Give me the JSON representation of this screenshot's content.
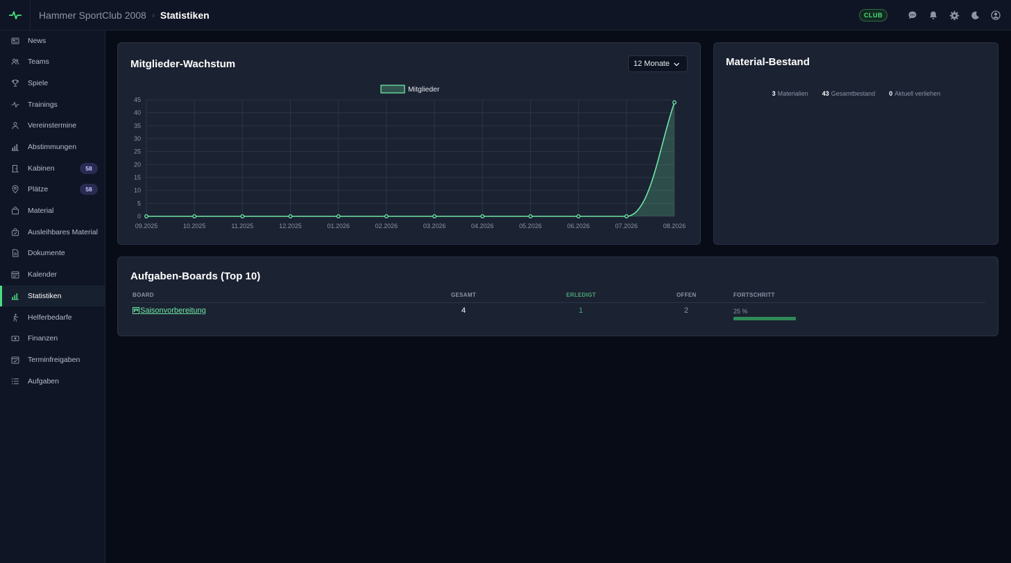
{
  "header": {
    "club_name": "Hammer SportClub 2008",
    "page_title": "Statistiken",
    "badge": "CLUB"
  },
  "icons": {
    "logo": "pulse-icon",
    "chat": "chat-icon",
    "notifications": "bell-icon",
    "settings": "gear-icon",
    "theme": "moon-icon",
    "account": "user-circle-icon"
  },
  "colors": {
    "accent": "#4ade80",
    "series": "#6ee7a6",
    "badge_bg": "#2a2a52"
  },
  "sidebar": {
    "items": [
      {
        "label": "News",
        "icon": "newspaper-icon"
      },
      {
        "label": "Teams",
        "icon": "users-icon"
      },
      {
        "label": "Spiele",
        "icon": "trophy-icon"
      },
      {
        "label": "Trainings",
        "icon": "pulse-icon"
      },
      {
        "label": "Vereinstermine",
        "icon": "person-icon"
      },
      {
        "label": "Abstimmungen",
        "icon": "bar-chart-icon"
      },
      {
        "label": "Kabinen",
        "icon": "door-icon",
        "badge": "58"
      },
      {
        "label": "Plätze",
        "icon": "map-pin-icon",
        "badge": "58"
      },
      {
        "label": "Material",
        "icon": "bag-icon"
      },
      {
        "label": "Ausleihbares Material",
        "icon": "bag-check-icon"
      },
      {
        "label": "Dokumente",
        "icon": "document-icon"
      },
      {
        "label": "Kalender",
        "icon": "calendar-icon"
      },
      {
        "label": "Statistiken",
        "icon": "bar-chart-icon",
        "active": true
      },
      {
        "label": "Helferbedarfe",
        "icon": "person-walking-icon"
      },
      {
        "label": "Finanzen",
        "icon": "cash-icon"
      },
      {
        "label": "Terminfreigaben",
        "icon": "calendar-check-icon"
      },
      {
        "label": "Aufgaben",
        "icon": "list-icon"
      }
    ]
  },
  "growth": {
    "title": "Mitglieder-Wachstum",
    "range_select": "12 Monate"
  },
  "chart_data": {
    "type": "area",
    "title": "",
    "x": [
      "09.2025",
      "10.2025",
      "11.2025",
      "12.2025",
      "01.2026",
      "02.2026",
      "03.2026",
      "04.2026",
      "05.2026",
      "06.2026",
      "07.2026",
      "08.2026"
    ],
    "series": [
      {
        "name": "Mitglieder",
        "values": [
          0,
          0,
          0,
          0,
          0,
          0,
          0,
          0,
          0,
          0,
          0,
          44
        ]
      }
    ],
    "y_ticks": [
      "0",
      "5",
      "10",
      "15",
      "20",
      "25",
      "30",
      "35",
      "40",
      "45"
    ],
    "ylim": [
      0,
      45
    ],
    "legend": "top-center",
    "grid": true
  },
  "material": {
    "title": "Material-Bestand",
    "stats": [
      {
        "value": "3",
        "label": "Materialien"
      },
      {
        "value": "43",
        "label": "Gesamtbestand"
      },
      {
        "value": "0",
        "label": "Aktuell verliehen"
      }
    ]
  },
  "boards": {
    "title": "Aufgaben-Boards (Top 10)",
    "columns": [
      "BOARD",
      "GESAMT",
      "ERLEDIGT",
      "OFFEN",
      "FORTSCHRITT"
    ],
    "rows": [
      {
        "board": "Saisonvorbereitung",
        "gesamt": "4",
        "erledigt": "1",
        "offen": "2",
        "progress_label": "25 %",
        "progress": 0.25
      }
    ]
  }
}
